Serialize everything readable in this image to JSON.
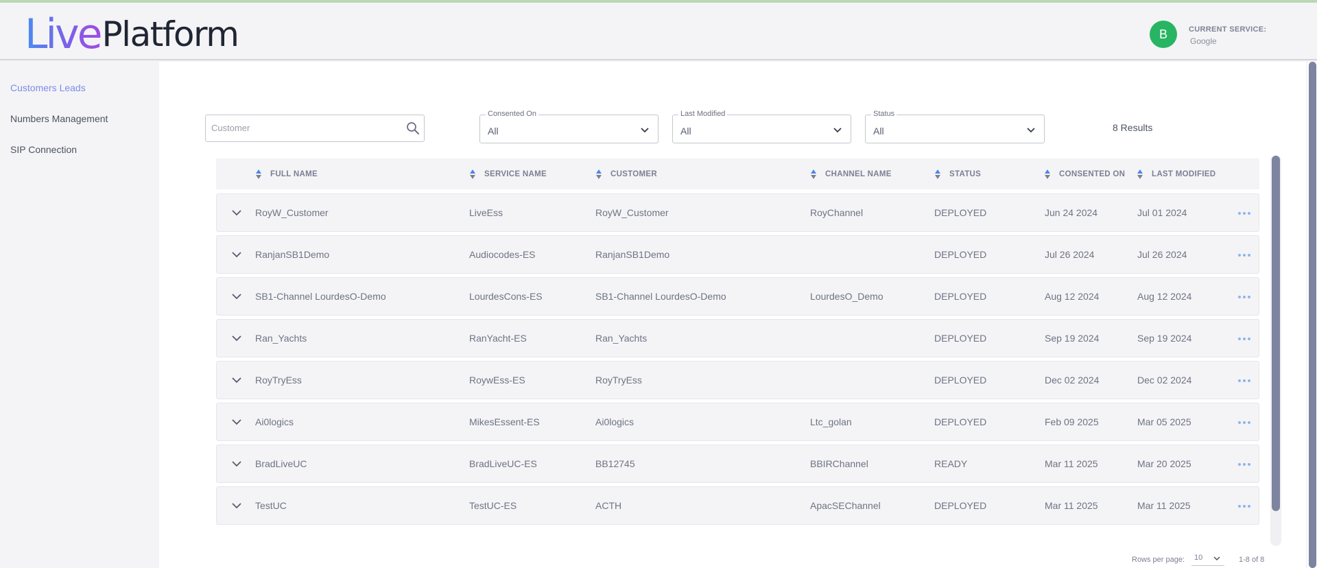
{
  "brand": {
    "logo_part1": "Live",
    "logo_part2": "Platform"
  },
  "header": {
    "avatar_initial": "B",
    "service_label": "CURRENT SERVICE:",
    "service_value": "Google"
  },
  "sidebar": {
    "items": [
      {
        "label": "Customers Leads",
        "active": true
      },
      {
        "label": "Numbers Management",
        "active": false
      },
      {
        "label": "SIP Connection",
        "active": false
      }
    ]
  },
  "filters": {
    "search_placeholder": "Customer",
    "consented_on": {
      "label": "Consented On",
      "value": "All"
    },
    "last_modified": {
      "label": "Last Modified",
      "value": "All"
    },
    "status": {
      "label": "Status",
      "value": "All"
    },
    "results": "8 Results"
  },
  "table": {
    "columns": [
      "FULL NAME",
      "SERVICE NAME",
      "CUSTOMER",
      "CHANNEL NAME",
      "STATUS",
      "CONSENTED ON",
      "LAST MODIFIED"
    ],
    "rows": [
      [
        "RoyW_Customer",
        "LiveEss",
        "RoyW_Customer",
        "RoyChannel",
        "DEPLOYED",
        "Jun 24 2024",
        "Jul 01 2024"
      ],
      [
        "RanjanSB1Demo",
        "Audiocodes-ES",
        "RanjanSB1Demo",
        "",
        "DEPLOYED",
        "Jul 26 2024",
        "Jul 26 2024"
      ],
      [
        "SB1-Channel LourdesO-Demo",
        "LourdesCons-ES",
        "SB1-Channel LourdesO-Demo",
        "LourdesO_Demo",
        "DEPLOYED",
        "Aug 12 2024",
        "Aug 12 2024"
      ],
      [
        "Ran_Yachts",
        "RanYacht-ES",
        "Ran_Yachts",
        "",
        "DEPLOYED",
        "Sep 19 2024",
        "Sep 19 2024"
      ],
      [
        "RoyTryEss",
        "RoywEss-ES",
        "RoyTryEss",
        "",
        "DEPLOYED",
        "Dec 02 2024",
        "Dec 02 2024"
      ],
      [
        "Ai0logics",
        "MikesEssent-ES",
        "Ai0logics",
        "Ltc_golan",
        "DEPLOYED",
        "Feb 09 2025",
        "Mar 05 2025"
      ],
      [
        "BradLiveUC",
        "BradLiveUC-ES",
        "BB12745",
        "BBIRChannel",
        "READY",
        "Mar 11 2025",
        "Mar 20 2025"
      ],
      [
        "TestUC",
        "TestUC-ES",
        "ACTH",
        "ApacSEChannel",
        "DEPLOYED",
        "Mar 11 2025",
        "Mar 11 2025"
      ]
    ]
  },
  "footer": {
    "rows_per_page_label": "Rows per page:",
    "rows_per_page_value": "10",
    "pagination": "1-8 of 8"
  },
  "colors": {
    "accent": "#7a8ce8",
    "avatar": "#27b563",
    "sort_up": "#4a86e8",
    "sort_down": "#7b8092",
    "more_dots": "#8fb3ef"
  },
  "icons": {
    "search": "search-icon",
    "chevron": "chevron-down-icon",
    "sort": "sort-icon",
    "more": "more-icon"
  }
}
